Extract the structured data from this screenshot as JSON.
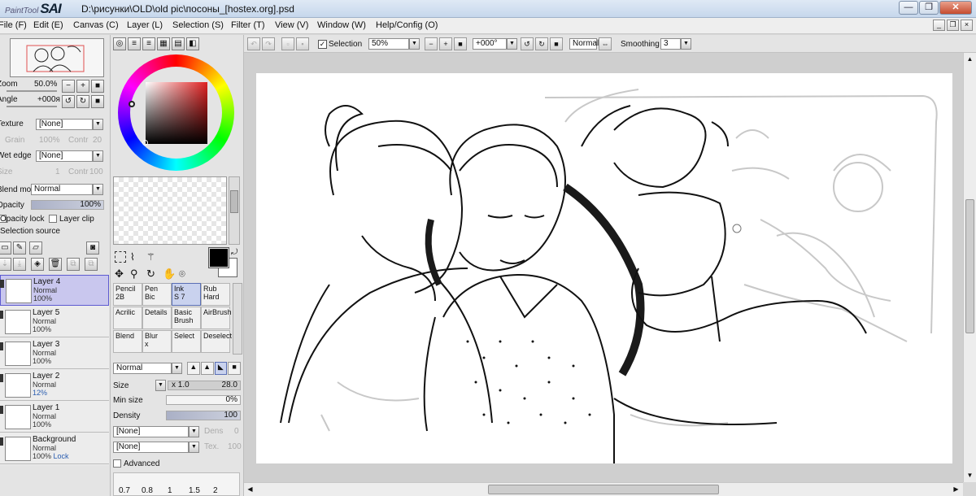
{
  "window": {
    "logo_small": "PaintTool",
    "logo_big": "SAI",
    "title": "D:\\рисунки\\OLD\\old pic\\посоны_[hostex.org].psd",
    "min": "—",
    "max": "❐",
    "close": "✕"
  },
  "menu": {
    "file": "File (F)",
    "edit": "Edit (E)",
    "canvas": "Canvas (C)",
    "layer": "Layer (L)",
    "selection": "Selection (S)",
    "filter": "Filter (T)",
    "view": "View (V)",
    "window": "Window (W)",
    "help": "Help/Config (O)"
  },
  "navigator": {
    "zoom_label": "Zoom",
    "zoom_value": "50.0%",
    "angle_label": "Angle",
    "angle_value": "+000я"
  },
  "paper": {
    "texture_label": "Texture",
    "texture_value": "[None]",
    "grain_label": "Grain",
    "grain_value": "100%",
    "contr_label": "Contr",
    "contr_value": "20",
    "wet_edge_label": "Wet edge",
    "wet_edge_value": "[None]",
    "size_label": "Size",
    "size_value": "1",
    "contr2_label": "Contr",
    "contr2_value": "100"
  },
  "layer_props": {
    "blend_label": "Blend mode",
    "blend_value": "Normal",
    "opacity_label": "Opacity",
    "opacity_value": "100%",
    "opacity_lock": "Opacity lock",
    "layer_clip": "Layer clip",
    "selection_source": "Selection source"
  },
  "layers": [
    {
      "name": "Layer 4",
      "mode": "Normal",
      "opacity": "100%",
      "selected": true
    },
    {
      "name": "Layer 5",
      "mode": "Normal",
      "opacity": "100%",
      "selected": false
    },
    {
      "name": "Layer 3",
      "mode": "Normal",
      "opacity": "100%",
      "selected": false
    },
    {
      "name": "Layer 2",
      "mode": "Normal",
      "opacity": "12%",
      "selected": false
    },
    {
      "name": "Layer 1",
      "mode": "Normal",
      "opacity": "100%",
      "selected": false
    },
    {
      "name": "Background",
      "mode": "Normal",
      "opacity": "100%",
      "lock": "Lock",
      "selected": false
    }
  ],
  "tools": [
    {
      "name": "Pencil",
      "sub": "2B"
    },
    {
      "name": "Pen",
      "sub": "Bic"
    },
    {
      "name": "Ink",
      "sub": "S 7"
    },
    {
      "name": "Rub",
      "sub": "Hard"
    },
    {
      "name": "Acrilic",
      "sub": ""
    },
    {
      "name": "Details",
      "sub": ""
    },
    {
      "name": "Basic",
      "sub": "Brush"
    },
    {
      "name": "AirBrush",
      "sub": ""
    },
    {
      "name": "Blend",
      "sub": ""
    },
    {
      "name": "Blur",
      "sub": "x"
    },
    {
      "name": "Select",
      "sub": ""
    },
    {
      "name": "Deselect",
      "sub": ""
    }
  ],
  "brush": {
    "mode": "Normal",
    "size_label": "Size",
    "size_mult": "x 1.0",
    "size_value": "28.0",
    "min_size_label": "Min size",
    "min_size_value": "0%",
    "density_label": "Density",
    "density_value": "100",
    "texture1": "[None]",
    "dens_label": "Dens",
    "dens_value": "0",
    "texture2": "[None]",
    "tex_label": "Tex.",
    "tex_value": "100",
    "advanced_label": "Advanced",
    "size_presets": [
      "0.7",
      "0.8",
      "1",
      "1.5",
      "2"
    ]
  },
  "toolbar": {
    "selection_label": "Selection",
    "zoom": "50%",
    "angle": "+000°",
    "blend": "Normal",
    "smoothing_label": "Smoothing",
    "smoothing_value": "3"
  },
  "colors": {
    "primary": "#000000",
    "selected_layer": "#c9c7ee",
    "accent": "#5d5bd0"
  }
}
